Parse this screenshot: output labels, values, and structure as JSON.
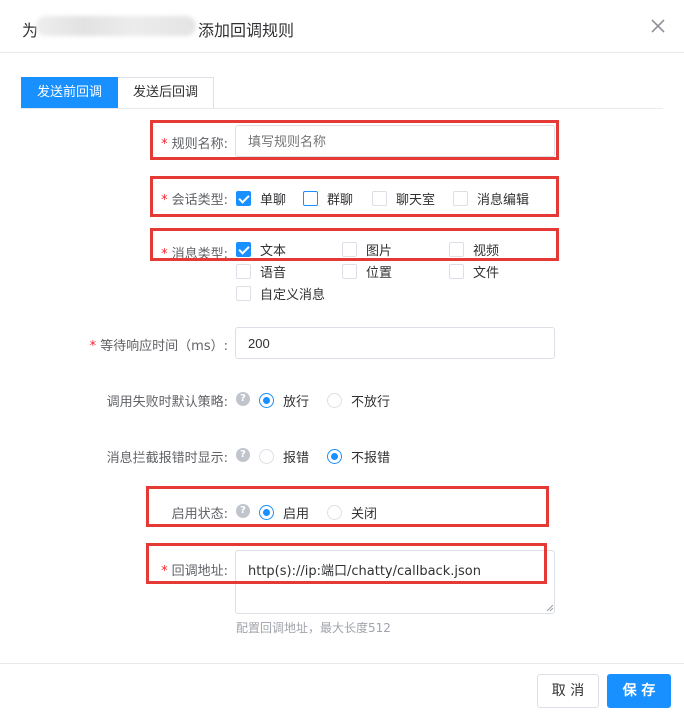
{
  "dialog": {
    "title_prefix": "为",
    "title_suffix": "添加回调规则"
  },
  "tabs": [
    {
      "label": "发送前回调",
      "active": true
    },
    {
      "label": "发送后回调",
      "active": false
    }
  ],
  "form": {
    "rule_name": {
      "label": "规则名称:",
      "required": "*",
      "placeholder": "填写规则名称",
      "value": ""
    },
    "conversation_type": {
      "label": "会话类型:",
      "required": "*",
      "options": [
        {
          "label": "单聊",
          "checked": true
        },
        {
          "label": "群聊",
          "checked": false
        },
        {
          "label": "聊天室",
          "checked": false
        },
        {
          "label": "消息编辑",
          "checked": false
        }
      ]
    },
    "message_type": {
      "label": "消息类型:",
      "required": "*",
      "options": [
        {
          "label": "文本",
          "checked": true
        },
        {
          "label": "图片",
          "checked": false
        },
        {
          "label": "视频",
          "checked": false
        },
        {
          "label": "语音",
          "checked": false
        },
        {
          "label": "位置",
          "checked": false
        },
        {
          "label": "文件",
          "checked": false
        },
        {
          "label": "自定义消息",
          "checked": false
        }
      ]
    },
    "wait_timeout": {
      "label": "等待响应时间（ms）:",
      "required": "*",
      "value": "200"
    },
    "failure_policy": {
      "label": "调用失败时默认策略:",
      "help": "?",
      "options": [
        {
          "label": "放行",
          "checked": true
        },
        {
          "label": "不放行",
          "checked": false
        }
      ]
    },
    "intercept_error_display": {
      "label": "消息拦截报错时显示:",
      "help": "?",
      "options": [
        {
          "label": "报错",
          "checked": false
        },
        {
          "label": "不报错",
          "checked": true
        }
      ]
    },
    "enable_status": {
      "label": "启用状态:",
      "help": "?",
      "options": [
        {
          "label": "启用",
          "checked": true
        },
        {
          "label": "关闭",
          "checked": false
        }
      ]
    },
    "callback_url": {
      "label": "回调地址:",
      "required": "*",
      "value": "http(s)://ip:端口/chatty/callback.json",
      "hint": "配置回调地址，最大长度512"
    }
  },
  "footer": {
    "cancel_label": "取 消",
    "save_label": "保 存"
  },
  "colors": {
    "primary": "#1890ff",
    "highlight_box": "#e53935",
    "required": "#f5222d"
  },
  "icons": {
    "close": "close-icon",
    "help": "help-icon",
    "resize": "resize-handle-icon"
  }
}
